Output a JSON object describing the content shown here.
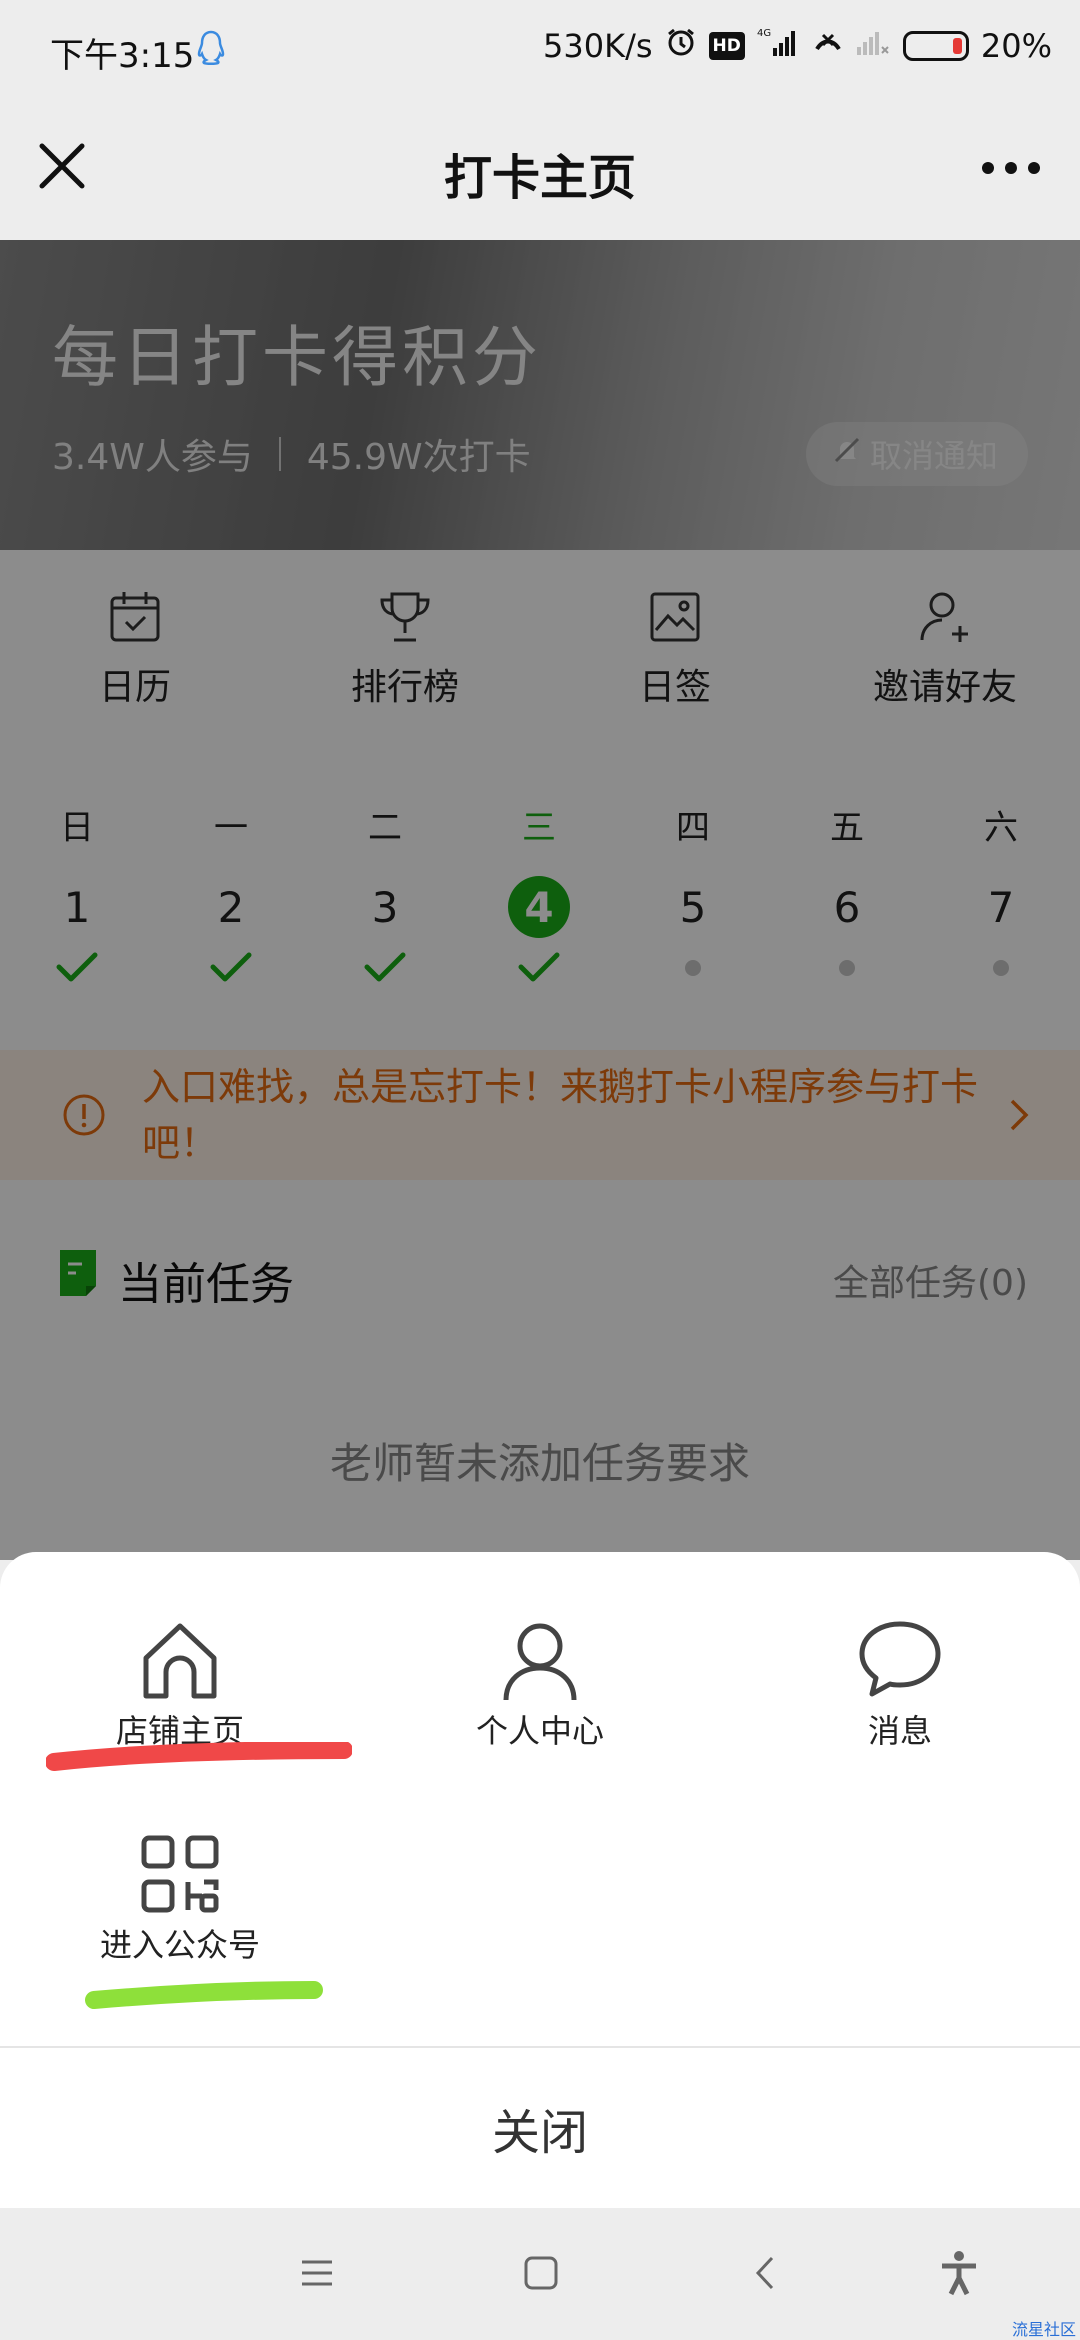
{
  "status_bar": {
    "time": "下午3:15",
    "net_speed": "530K/s",
    "hd": "HD",
    "network": "4G",
    "battery": "20%",
    "battery_level": 0.2
  },
  "nav": {
    "title": "打卡主页"
  },
  "hero": {
    "title": "每日打卡得积分",
    "participants": "3.4W人参与",
    "checkins": "45.9W次打卡",
    "notify_button": "取消通知"
  },
  "menu": [
    {
      "label": "日历",
      "icon": "calendar-icon"
    },
    {
      "label": "排行榜",
      "icon": "trophy-icon"
    },
    {
      "label": "日签",
      "icon": "image-icon"
    },
    {
      "label": "邀请好友",
      "icon": "add-user-icon"
    }
  ],
  "week": [
    {
      "name": "日",
      "num": "1",
      "status": "done"
    },
    {
      "name": "一",
      "num": "2",
      "status": "done"
    },
    {
      "name": "二",
      "num": "3",
      "status": "done"
    },
    {
      "name": "三",
      "num": "4",
      "status": "today-done"
    },
    {
      "name": "四",
      "num": "5",
      "status": "pending"
    },
    {
      "name": "五",
      "num": "6",
      "status": "pending"
    },
    {
      "name": "六",
      "num": "7",
      "status": "pending"
    }
  ],
  "notice": {
    "text": "入口难找，总是忘打卡！来鹅打卡小程序参与打卡吧！"
  },
  "tasks": {
    "title": "当前任务",
    "all_link": "全部任务(0)",
    "empty": "老师暂未添加任务要求"
  },
  "sheet": {
    "items": [
      {
        "label": "店铺主页",
        "icon": "home-icon"
      },
      {
        "label": "个人中心",
        "icon": "person-icon"
      },
      {
        "label": "消息",
        "icon": "chat-bubble-icon"
      },
      {
        "label": "进入公众号",
        "icon": "qr-code-icon"
      }
    ],
    "close": "关闭"
  },
  "watermark": "流星社区",
  "colors": {
    "accent_green": "#1aad19",
    "notice_orange": "#e36b12",
    "highlight_red": "#f04848",
    "highlight_green": "#8ee03a"
  }
}
